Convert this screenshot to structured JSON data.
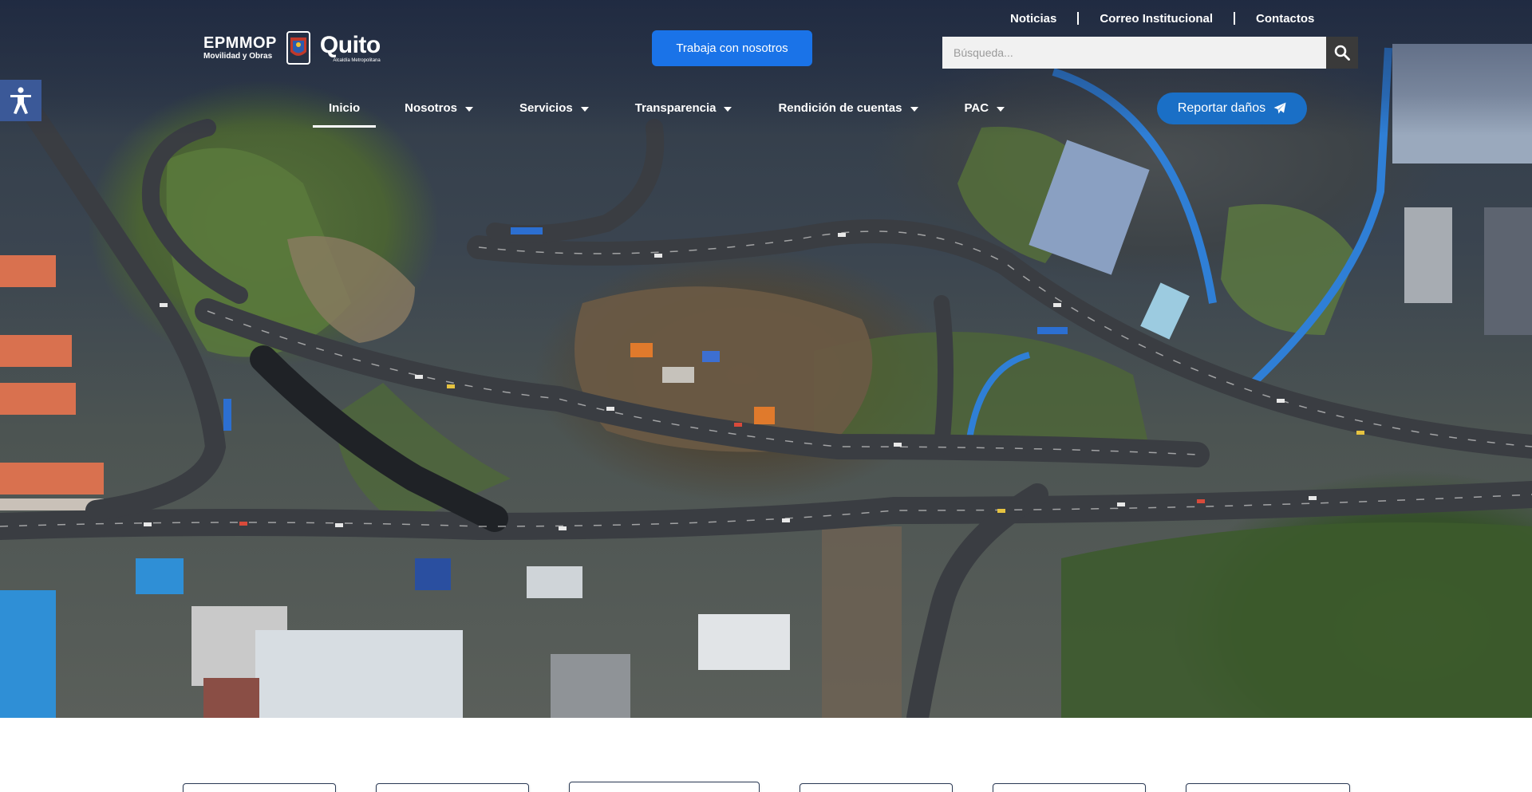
{
  "logo": {
    "epmmop_title": "EPMMOP",
    "epmmop_subtitle": "Movilidad y Obras",
    "quito_title": "Quito",
    "quito_subtitle": "Alcaldía Metropolitana"
  },
  "top_links": [
    {
      "label": "Noticias"
    },
    {
      "label": "Correo Institucional"
    },
    {
      "label": "Contactos"
    }
  ],
  "work_button": {
    "label": "Trabaja con nosotros"
  },
  "search": {
    "placeholder": "Búsqueda...",
    "value": "",
    "icon": "search-icon"
  },
  "nav": {
    "items": [
      {
        "label": "Inicio",
        "active": true,
        "dropdown": false
      },
      {
        "label": "Nosotros",
        "active": false,
        "dropdown": true
      },
      {
        "label": "Servicios",
        "active": false,
        "dropdown": true
      },
      {
        "label": "Transparencia",
        "active": false,
        "dropdown": true
      },
      {
        "label": "Rendición de cuentas",
        "active": false,
        "dropdown": true
      },
      {
        "label": "PAC",
        "active": false,
        "dropdown": true
      }
    ]
  },
  "report_button": {
    "label": "Reportar daños",
    "icon": "paper-plane-icon"
  },
  "accessibility_button": {
    "icon": "accessibility-person-icon"
  },
  "colors": {
    "primary_blue": "#1a73e8",
    "report_blue": "#1a6fc6",
    "accessibility_blue": "#3b5998",
    "search_button": "#3a3a3a"
  },
  "cards_count": 6
}
